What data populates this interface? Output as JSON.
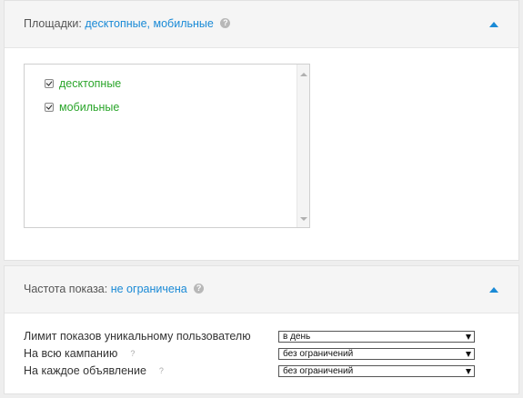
{
  "platforms": {
    "title_label": "Площадки:",
    "title_value": "десктопные, мобильные",
    "help": "?",
    "items": [
      {
        "label": "десктопные",
        "checked": true
      },
      {
        "label": "мобильные",
        "checked": true
      }
    ]
  },
  "frequency": {
    "title_label": "Частота показа:",
    "title_value": "не ограничена",
    "help": "?",
    "rows": [
      {
        "label": "Лимит показов уникальному пользователю",
        "help": "",
        "value": "в день"
      },
      {
        "label": "На всю кампанию",
        "help": "?",
        "value": "без ограничений"
      },
      {
        "label": "На каждое объявление",
        "help": "?",
        "value": "без ограничений"
      }
    ]
  },
  "colors": {
    "accent": "#1a8ad6",
    "checked_item": "#2aa52a",
    "header_bg": "#f5f5f5"
  }
}
